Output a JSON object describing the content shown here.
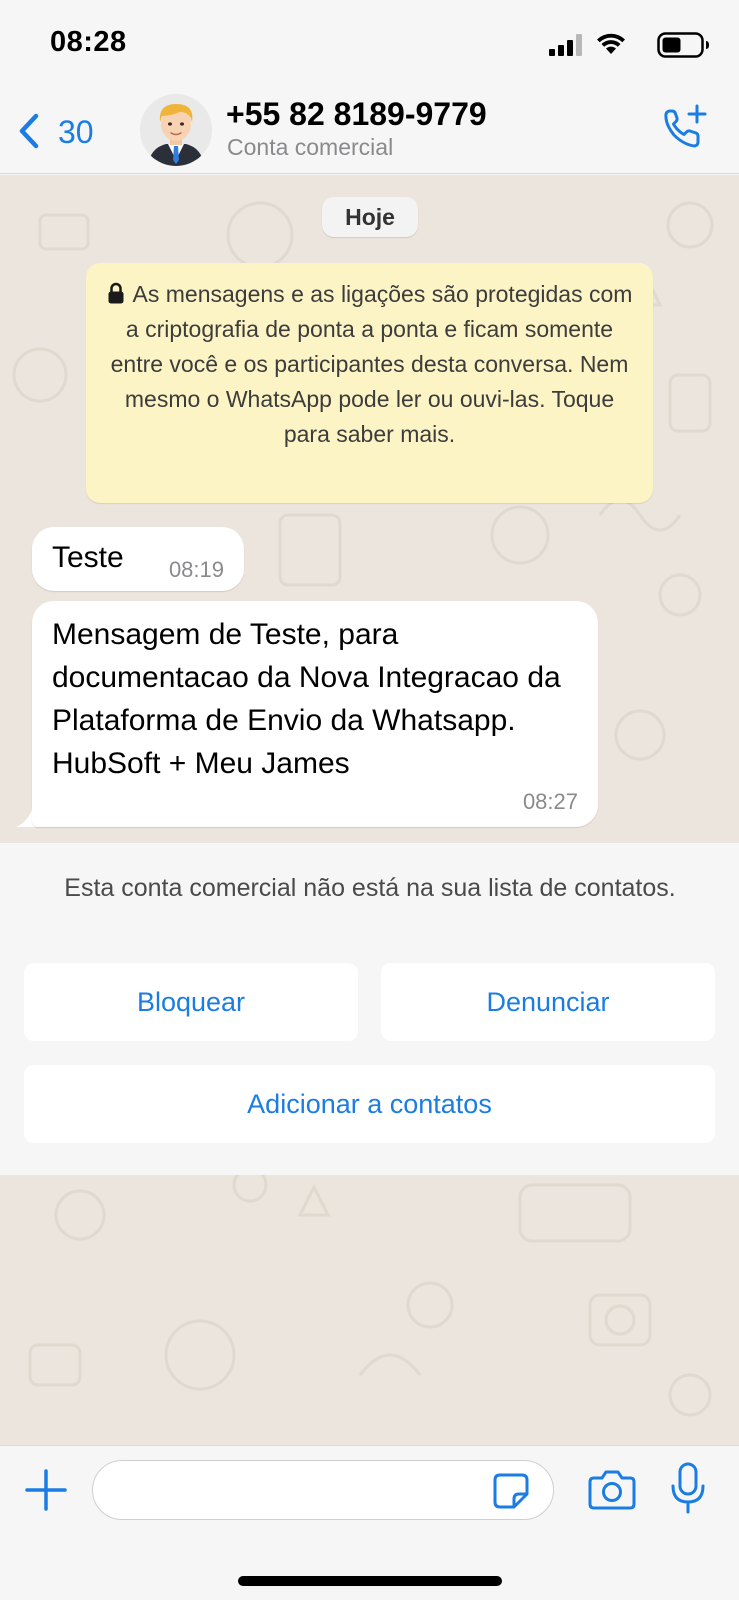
{
  "status_bar": {
    "time": "08:28",
    "icons": [
      "signal-icon",
      "wifi-icon",
      "battery-icon"
    ]
  },
  "header": {
    "back_count": "30",
    "contact_name": "+55 82 8189-9779",
    "contact_subtitle": "Conta comercial",
    "icons": [
      "chevron-left-icon",
      "avatar",
      "call-add-icon"
    ],
    "accent_color": "#1b7de4"
  },
  "chat": {
    "date_chip": "Hoje",
    "encryption_notice": "As mensagens e as ligações são protegidas com a criptografia de ponta a ponta e ficam somente entre você e os participantes desta conversa. Nem mesmo o WhatsApp pode ler ou ouvi-las. Toque para saber mais.",
    "messages": [
      {
        "text": "Teste",
        "time": "08:19"
      },
      {
        "text": "Mensagem de Teste, para documentacao da Nova Integracao da Plataforma de Envio da Whatsapp. HubSoft + Meu James",
        "time": "08:27"
      }
    ],
    "wallpaper_color": "#ece5dd",
    "notice_color": "#fdf4c5"
  },
  "business_panel": {
    "text": "Esta conta comercial não está na sua lista de contatos.",
    "block_label": "Bloquear",
    "report_label": "Denunciar",
    "add_label": "Adicionar a contatos"
  },
  "input_bar": {
    "placeholder": "",
    "icons": [
      "plus-icon",
      "sticker-icon",
      "camera-icon",
      "microphone-icon"
    ]
  }
}
